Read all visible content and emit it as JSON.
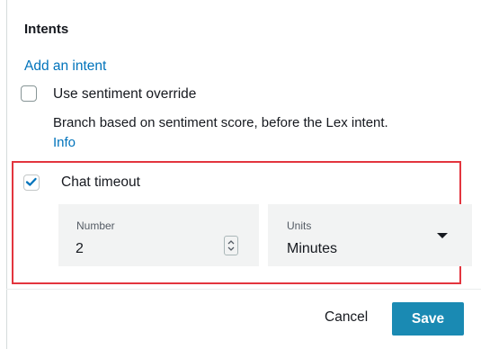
{
  "section": {
    "title": "Intents",
    "add_link": "Add an intent"
  },
  "sentiment": {
    "label": "Use sentiment override",
    "checked": false,
    "description": "Branch based on sentiment score, before the Lex intent.",
    "info_link": "Info"
  },
  "chat_timeout": {
    "label": "Chat timeout",
    "checked": true,
    "number_label": "Number",
    "number_value": "2",
    "units_label": "Units",
    "units_value": "Minutes"
  },
  "footer": {
    "cancel_label": "Cancel",
    "save_label": "Save"
  },
  "colors": {
    "link": "#0073bb",
    "primary_button": "#1a8ab3",
    "highlight_border": "#e3353e",
    "field_background": "#f2f3f3"
  },
  "icons": {
    "sentiment_checkbox": "checkbox-unchecked-icon",
    "chat_checkbox": "checkbox-checked-icon",
    "stepper": "stepper-up-down-icon",
    "dropdown": "caret-down-icon"
  }
}
